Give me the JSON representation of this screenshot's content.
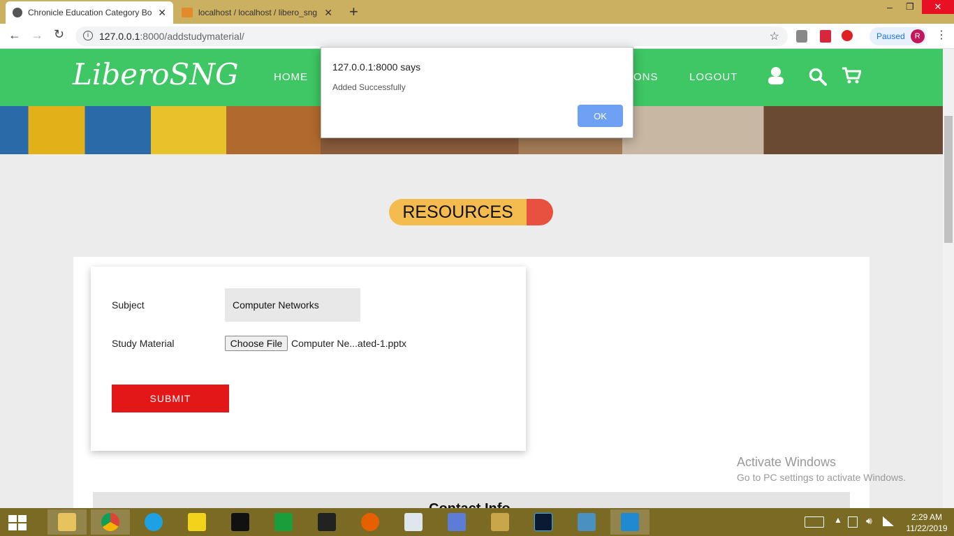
{
  "browser": {
    "tabs": [
      {
        "title": "Chronicle Education Category Bo"
      },
      {
        "title": "localhost / localhost / libero_sng"
      }
    ],
    "new_tab": "+",
    "window_controls": [
      "–",
      "❐",
      "✕"
    ],
    "address": {
      "host": "127.0.0.1",
      "path": ":8000/addstudymaterial/"
    },
    "profile_status": "Paused",
    "profile_initial": "R"
  },
  "site": {
    "logo": "LiberoSNG",
    "nav": {
      "home": "HOME",
      "partial": "ONS",
      "logout": "LOGOUT"
    },
    "icons": [
      "user-icon",
      "search-icon",
      "cart-icon"
    ]
  },
  "main": {
    "section_title": "RESOURCES",
    "form": {
      "subject_label": "Subject",
      "subject_value": "Computer Networks",
      "material_label": "Study Material",
      "choose_file_label": "Choose File",
      "file_name": "Computer Ne...ated-1.pptx",
      "submit_label": "SUBMIT"
    },
    "contact_title": "Contact Info"
  },
  "dialog": {
    "title": "127.0.0.1:8000 says",
    "message": "Added Successfully",
    "ok_label": "OK"
  },
  "watermark": {
    "line1": "Activate Windows",
    "line2": "Go to PC settings to activate Windows."
  },
  "taskbar": {
    "apps": [
      "file-explorer-icon",
      "chrome-icon",
      "ie-icon",
      "app-icon",
      "cmd-icon",
      "store-icon",
      "nfs-icon",
      "firefox-icon",
      "app2-icon",
      "app3-icon",
      "app4-icon",
      "photoshop-icon",
      "photos-icon",
      "vscode-icon"
    ],
    "time": "2:29 AM",
    "date": "11/22/2019"
  },
  "colors": {
    "nav_green": "#3ec764",
    "submit_red": "#e31717",
    "pill_yellow": "#f4bb4f",
    "pill_red": "#e8503f",
    "ok_blue": "#6ea0f3"
  }
}
